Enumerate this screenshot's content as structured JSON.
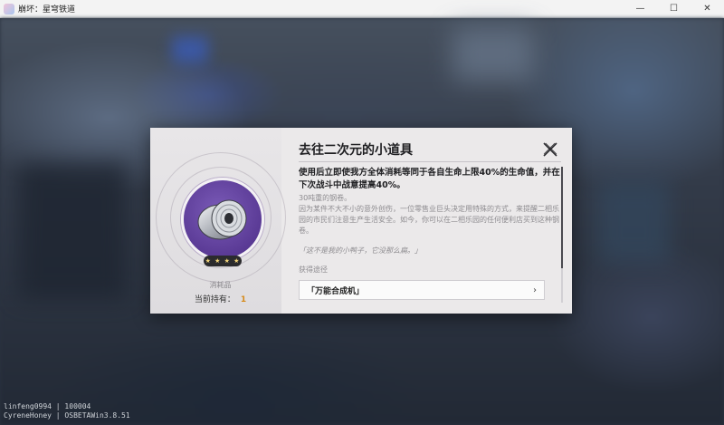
{
  "window": {
    "title": "崩坏：星穹铁道",
    "controls": [
      "—",
      "☐",
      "✕"
    ]
  },
  "dialog": {
    "item_name": "去往二次元的小道具",
    "description": "使用后立即使我方全体消耗等同于各自生命上限40%的生命值，并在下次战斗中战意提高40%。",
    "lore_subtitle": "30吨重的钢卷。",
    "lore": "因为某件不大不小的意外创伤，一位零售业巨头决定用特殊的方式，来提醒二相乐园的市民们注意生产生活安全。如今，你可以在二相乐园的任何便利店买到这种钢卷。",
    "quote": "「这不是我的小鸭子，它没那么扁。」",
    "source_label": "获得途径",
    "source_button": "「万能合成机」",
    "stars": "★ ★ ★ ★",
    "category": "消耗品",
    "owned_label": "当前持有：",
    "owned_count": "1"
  },
  "footer": {
    "line1": "linfeng0994 | 100004",
    "line2": "CyreneHoney | OSBETAWin3.8.51"
  },
  "colors": {
    "accent_count": "#d68a1b",
    "item_bg": "#5a3a95"
  },
  "icons": {
    "close": "close-icon",
    "chevron": "chevron-right-icon"
  }
}
